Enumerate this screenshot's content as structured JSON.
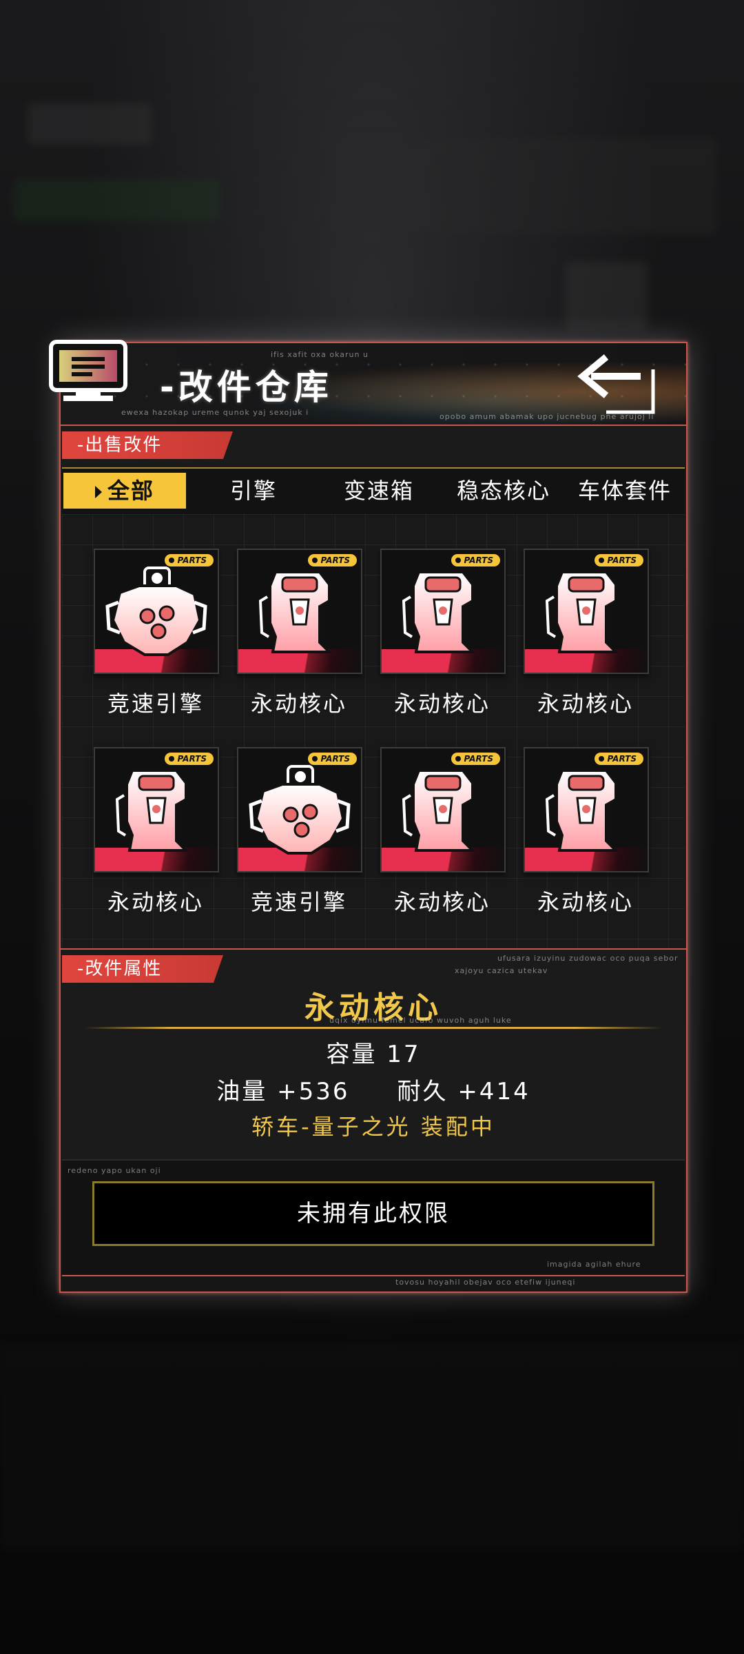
{
  "header": {
    "title": "-改件仓库",
    "icon": "monitor-icon",
    "back_icon": "back-arrow-icon",
    "micro_top": "ifis xafit oxa okarun u",
    "micro_left": "ewexa hazokap ureme qunok yaj sexojuk i",
    "micro_right": "opobo amum abamak upo jucnebug pne arujoj li"
  },
  "sell_section": {
    "label": "-出售改件"
  },
  "tabs": [
    {
      "label": "全部",
      "active": true
    },
    {
      "label": "引擎",
      "active": false
    },
    {
      "label": "变速箱",
      "active": false
    },
    {
      "label": "稳态核心",
      "active": false
    },
    {
      "label": "车体套件",
      "active": false
    }
  ],
  "badge_text": "PARTS",
  "items": [
    {
      "name": "竞速引擎",
      "kind": "engine"
    },
    {
      "name": "永动核心",
      "kind": "core"
    },
    {
      "name": "永动核心",
      "kind": "core"
    },
    {
      "name": "永动核心",
      "kind": "core"
    },
    {
      "name": "永动核心",
      "kind": "core"
    },
    {
      "name": "竞速引擎",
      "kind": "engine"
    },
    {
      "name": "永动核心",
      "kind": "core"
    },
    {
      "name": "永动核心",
      "kind": "core"
    }
  ],
  "attr_section": {
    "label": "-改件属性",
    "micro_1": "ufusara izuyinu zudowac oco puqa sebor",
    "micro_2": "xajoyu cazica utekav",
    "micro_3": "uqix oyimu femel ucafo wuvoh aguh luke"
  },
  "selected": {
    "name": "永动核心",
    "capacity": "容量 17",
    "stats": "油量 +536     耐久 +414",
    "equipped": "轿车-量子之光 装配中"
  },
  "bottom": {
    "micro_1": "redeno yapo ukan oji",
    "micro_2": "imagida agilah ehure",
    "micro_3": "tovosu hoyahil obejav oco etefiw ijuneqi",
    "button_label": "未拥有此权限"
  },
  "colors": {
    "accent_red": "#e0463e",
    "accent_gold": "#f6c53a",
    "item_pink": "#ff3356"
  }
}
